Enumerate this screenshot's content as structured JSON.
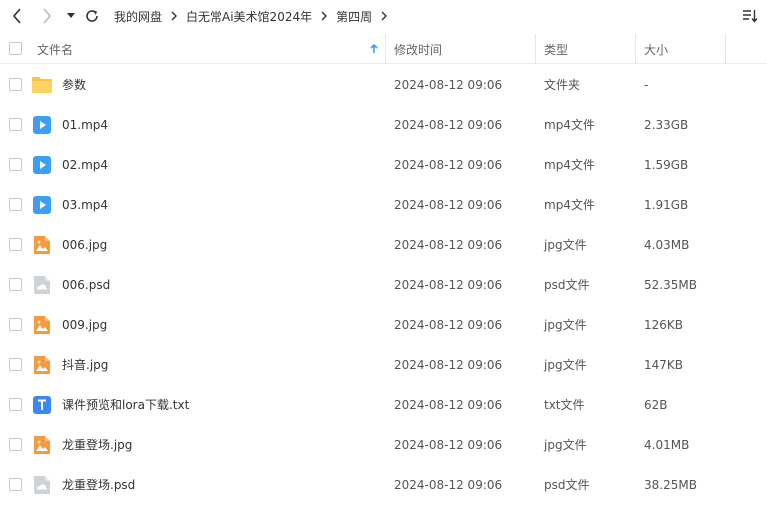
{
  "breadcrumb": [
    "我的网盘",
    "白无常Ai美术馆2024年",
    "第四周"
  ],
  "header": {
    "name": "文件名",
    "modified": "修改时间",
    "type": "类型",
    "size": "大小"
  },
  "colors": {
    "folder": "#f7c54a",
    "video": "#3d9ef5",
    "image": "#f59a3d",
    "psd": "#cfd3d8",
    "txt": "#3d87f5",
    "sort_arrow": "#3d9ef5"
  },
  "files": [
    {
      "icon": "folder-icon",
      "name": "参数",
      "modified": "2024-08-12 09:06",
      "type": "文件夹",
      "size": "-"
    },
    {
      "icon": "video-file-icon",
      "name": "01.mp4",
      "modified": "2024-08-12 09:06",
      "type": "mp4文件",
      "size": "2.33GB"
    },
    {
      "icon": "video-file-icon",
      "name": "02.mp4",
      "modified": "2024-08-12 09:06",
      "type": "mp4文件",
      "size": "1.59GB"
    },
    {
      "icon": "video-file-icon",
      "name": "03.mp4",
      "modified": "2024-08-12 09:06",
      "type": "mp4文件",
      "size": "1.91GB"
    },
    {
      "icon": "image-file-icon",
      "name": "006.jpg",
      "modified": "2024-08-12 09:06",
      "type": "jpg文件",
      "size": "4.03MB"
    },
    {
      "icon": "psd-file-icon",
      "name": "006.psd",
      "modified": "2024-08-12 09:06",
      "type": "psd文件",
      "size": "52.35MB"
    },
    {
      "icon": "image-file-icon",
      "name": "009.jpg",
      "modified": "2024-08-12 09:06",
      "type": "jpg文件",
      "size": "126KB"
    },
    {
      "icon": "image-file-icon",
      "name": "抖音.jpg",
      "modified": "2024-08-12 09:06",
      "type": "jpg文件",
      "size": "147KB"
    },
    {
      "icon": "text-file-icon",
      "name": "课件预览和lora下载.txt",
      "modified": "2024-08-12 09:06",
      "type": "txt文件",
      "size": "62B"
    },
    {
      "icon": "image-file-icon",
      "name": "龙重登场.jpg",
      "modified": "2024-08-12 09:06",
      "type": "jpg文件",
      "size": "4.01MB"
    },
    {
      "icon": "psd-file-icon",
      "name": "龙重登场.psd",
      "modified": "2024-08-12 09:06",
      "type": "psd文件",
      "size": "38.25MB"
    }
  ]
}
